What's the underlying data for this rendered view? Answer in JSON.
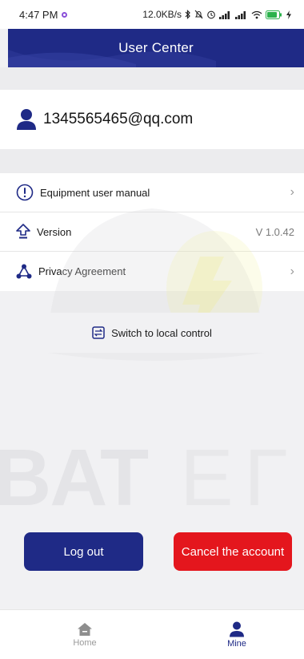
{
  "status_bar": {
    "time": "4:47 PM",
    "network_speed": "12.0KB/s"
  },
  "header": {
    "title": "User Center"
  },
  "user": {
    "email": "1345565465@qq.com"
  },
  "menu": {
    "items": [
      {
        "label": "Equipment user manual",
        "icon": "info-circle-icon",
        "trailing": "chevron"
      },
      {
        "label": "Version",
        "icon": "upload-arrow-icon",
        "value": "V 1.0.42"
      },
      {
        "label": "Privacy Agreement",
        "icon": "privacy-nodes-icon",
        "trailing": "chevron"
      }
    ]
  },
  "switch_local": {
    "label": "Switch to local control",
    "icon": "switch-icon"
  },
  "actions": {
    "logout_label": "Log out",
    "cancel_account_label": "Cancel the account"
  },
  "tabbar": {
    "home_label": "Home",
    "mine_label": "Mine"
  },
  "colors": {
    "primary": "#1f2a86",
    "danger": "#e4161d",
    "background": "#f1f1f3"
  }
}
